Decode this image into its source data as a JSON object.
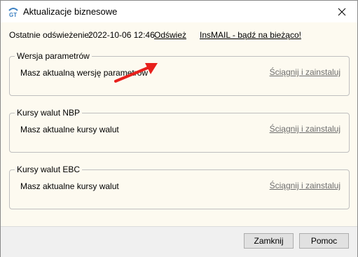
{
  "window": {
    "title": "Aktualizacje biznesowe",
    "icon": "gt-app-icon"
  },
  "refresh": {
    "label": "Ostatnie odświeżenie:",
    "value": "2022-10-06 12:46",
    "refresh_link": "Odśwież",
    "insmail_link": "InsMAIL - bądź na bieżąco!"
  },
  "groups": [
    {
      "title": "Wersja parametrów",
      "status": "Masz aktualną wersję parametrów",
      "action": "Ściągnij i zainstaluj"
    },
    {
      "title": "Kursy walut NBP",
      "status": "Masz aktualne kursy walut",
      "action": "Ściągnij i zainstaluj"
    },
    {
      "title": "Kursy walut EBC",
      "status": "Masz aktualne kursy walut",
      "action": "Ściągnij i zainstaluj"
    }
  ],
  "buttons": {
    "close": "Zamknij",
    "help": "Pomoc"
  },
  "colors": {
    "client_background": "#fdfaf0",
    "disabled_link": "#6d6d6d",
    "annotation_arrow": "#e8201c"
  }
}
